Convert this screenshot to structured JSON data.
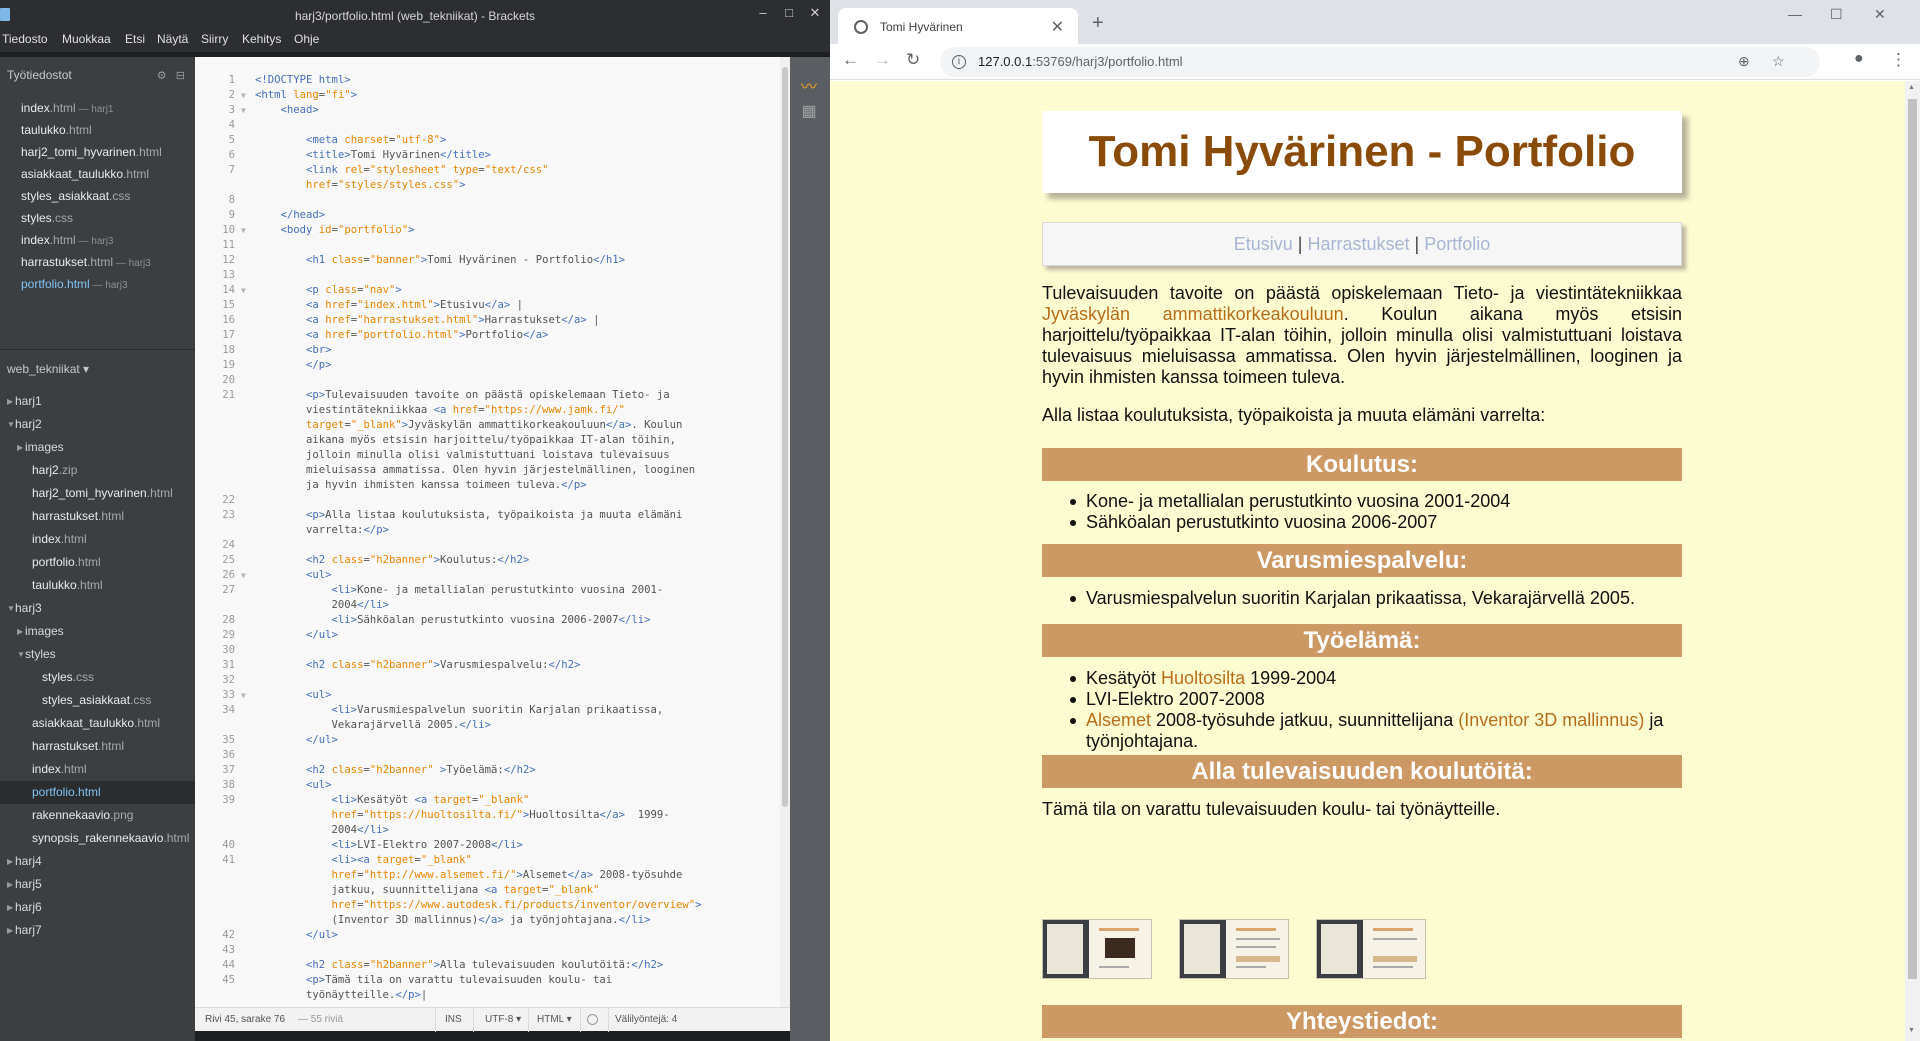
{
  "brackets": {
    "window_title": "harj3/portfolio.html (web_tekniikat) - Brackets",
    "menu": [
      "Tiedosto",
      "Muokkaa",
      "Etsi",
      "Näytä",
      "Siirry",
      "Kehitys",
      "Ohje"
    ],
    "working_files_header": "Työtiedostot",
    "working_files": [
      {
        "name": "index",
        "ext": ".html",
        "dir": " — harj1"
      },
      {
        "name": "taulukko",
        "ext": ".html",
        "dir": ""
      },
      {
        "name": "harj2_tomi_hyvarinen",
        "ext": ".html",
        "dir": ""
      },
      {
        "name": "asiakkaat_taulukko",
        "ext": ".html",
        "dir": ""
      },
      {
        "name": "styles_asiakkaat",
        "ext": ".css",
        "dir": ""
      },
      {
        "name": "styles",
        "ext": ".css",
        "dir": ""
      },
      {
        "name": "index",
        "ext": ".html",
        "dir": " — harj3"
      },
      {
        "name": "harrastukset",
        "ext": ".html",
        "dir": " — harj3"
      },
      {
        "name": "portfolio",
        "ext": ".html",
        "dir": " — harj3"
      }
    ],
    "project_name": "web_tekniikat ▾",
    "tree": [
      {
        "label": "harj1",
        "ext": "",
        "type": "folder",
        "open": false,
        "indent": 0
      },
      {
        "label": "harj2",
        "ext": "",
        "type": "folder",
        "open": true,
        "indent": 0
      },
      {
        "label": "images",
        "ext": "",
        "type": "folder",
        "open": false,
        "indent": 1
      },
      {
        "label": "harj2",
        "ext": ".zip",
        "type": "file",
        "indent": 1
      },
      {
        "label": "harj2_tomi_hyvarinen",
        "ext": ".html",
        "type": "file",
        "indent": 1
      },
      {
        "label": "harrastukset",
        "ext": ".html",
        "type": "file",
        "indent": 1
      },
      {
        "label": "index",
        "ext": ".html",
        "type": "file",
        "indent": 1
      },
      {
        "label": "portfolio",
        "ext": ".html",
        "type": "file",
        "indent": 1
      },
      {
        "label": "taulukko",
        "ext": ".html",
        "type": "file",
        "indent": 1
      },
      {
        "label": "harj3",
        "ext": "",
        "type": "folder",
        "open": true,
        "indent": 0
      },
      {
        "label": "images",
        "ext": "",
        "type": "folder",
        "open": false,
        "indent": 1
      },
      {
        "label": "styles",
        "ext": "",
        "type": "folder",
        "open": true,
        "indent": 1
      },
      {
        "label": "styles",
        "ext": ".css",
        "type": "file",
        "indent": 2
      },
      {
        "label": "styles_asiakkaat",
        "ext": ".css",
        "type": "file",
        "indent": 2
      },
      {
        "label": "asiakkaat_taulukko",
        "ext": ".html",
        "type": "file",
        "indent": 1
      },
      {
        "label": "harrastukset",
        "ext": ".html",
        "type": "file",
        "indent": 1
      },
      {
        "label": "index",
        "ext": ".html",
        "type": "file",
        "indent": 1
      },
      {
        "label": "portfolio",
        "ext": ".html",
        "type": "file",
        "indent": 1,
        "selected": true
      },
      {
        "label": "rakennekaavio",
        "ext": ".png",
        "type": "file",
        "indent": 1
      },
      {
        "label": "synopsis_rakennekaavio",
        "ext": ".html",
        "type": "file",
        "indent": 1
      },
      {
        "label": "harj4",
        "ext": "",
        "type": "folder",
        "open": false,
        "indent": 0
      },
      {
        "label": "harj5",
        "ext": "",
        "type": "folder",
        "open": false,
        "indent": 0
      },
      {
        "label": "harj6",
        "ext": "",
        "type": "folder",
        "open": false,
        "indent": 0
      },
      {
        "label": "harj7",
        "ext": "",
        "type": "folder",
        "open": false,
        "indent": 0
      }
    ],
    "code_lines": [
      {
        "n": "1",
        "fold": "",
        "html": "<span class=\"tg\">&lt;!DOCTYPE html&gt;</span>"
      },
      {
        "n": "2",
        "fold": "▼",
        "html": "<span class=\"tg\">&lt;html</span> <span class=\"at\">lang</span>=<span class=\"st\">\"fi\"</span><span class=\"tg\">&gt;</span>"
      },
      {
        "n": "3",
        "fold": "▼",
        "html": "    <span class=\"tg\">&lt;head&gt;</span>"
      },
      {
        "n": "4",
        "fold": "",
        "html": ""
      },
      {
        "n": "5",
        "fold": "",
        "html": "        <span class=\"tg\">&lt;meta</span> <span class=\"at\">charset</span>=<span class=\"st\">\"utf-8\"</span><span class=\"tg\">&gt;</span>"
      },
      {
        "n": "6",
        "fold": "",
        "html": "        <span class=\"tg\">&lt;title&gt;</span>Tomi Hyvärinen<span class=\"tg\">&lt;/title&gt;</span>"
      },
      {
        "n": "7",
        "fold": "",
        "html": "        <span class=\"tg\">&lt;link</span> <span class=\"at\">rel</span>=<span class=\"st\">\"stylesheet\"</span> <span class=\"at\">type</span>=<span class=\"st\">\"text/css\"</span>"
      },
      {
        "n": "",
        "fold": "",
        "html": "        <span class=\"at\">href</span>=<span class=\"st\">\"styles/styles.css\"</span><span class=\"tg\">&gt;</span>"
      },
      {
        "n": "8",
        "fold": "",
        "html": ""
      },
      {
        "n": "9",
        "fold": "",
        "html": "    <span class=\"tg\">&lt;/head&gt;</span>"
      },
      {
        "n": "10",
        "fold": "▼",
        "html": "    <span class=\"tg\">&lt;body</span> <span class=\"at\">id</span>=<span class=\"st\">\"portfolio\"</span><span class=\"tg\">&gt;</span>"
      },
      {
        "n": "11",
        "fold": "",
        "html": ""
      },
      {
        "n": "12",
        "fold": "",
        "html": "        <span class=\"tg\">&lt;h1</span> <span class=\"at\">class</span>=<span class=\"st\">\"banner\"</span><span class=\"tg\">&gt;</span>Tomi Hyvärinen - Portfolio<span class=\"tg\">&lt;/h1&gt;</span>"
      },
      {
        "n": "13",
        "fold": "",
        "html": ""
      },
      {
        "n": "14",
        "fold": "▼",
        "html": "        <span class=\"tg\">&lt;p</span> <span class=\"at\">class</span>=<span class=\"st\">\"nav\"</span><span class=\"tg\">&gt;</span>"
      },
      {
        "n": "15",
        "fold": "",
        "html": "        <span class=\"tg\">&lt;a</span> <span class=\"at\">href</span>=<span class=\"st\">\"index.html\"</span><span class=\"tg\">&gt;</span>Etusivu<span class=\"tg\">&lt;/a&gt;</span> |"
      },
      {
        "n": "16",
        "fold": "",
        "html": "        <span class=\"tg\">&lt;a</span> <span class=\"at\">href</span>=<span class=\"st\">\"harrastukset.html\"</span><span class=\"tg\">&gt;</span>Harrastukset<span class=\"tg\">&lt;/a&gt;</span> |"
      },
      {
        "n": "17",
        "fold": "",
        "html": "        <span class=\"tg\">&lt;a</span> <span class=\"at\">href</span>=<span class=\"st\">\"portfolio.html\"</span><span class=\"tg\">&gt;</span>Portfolio<span class=\"tg\">&lt;/a&gt;</span>"
      },
      {
        "n": "18",
        "fold": "",
        "html": "        <span class=\"tg\">&lt;br&gt;</span>"
      },
      {
        "n": "19",
        "fold": "",
        "html": "        <span class=\"tg\">&lt;/p&gt;</span>"
      },
      {
        "n": "20",
        "fold": "",
        "html": ""
      },
      {
        "n": "21",
        "fold": "",
        "html": "        <span class=\"tg\">&lt;p&gt;</span>Tulevaisuuden tavoite on päästä opiskelemaan Tieto- ja"
      },
      {
        "n": "",
        "fold": "",
        "html": "        viestintätekniikkaa <span class=\"tg\">&lt;a</span> <span class=\"at\">href</span>=<span class=\"st\">\"https://www.jamk.fi/\"</span>"
      },
      {
        "n": "",
        "fold": "",
        "html": "        <span class=\"at\">target</span>=<span class=\"st\">\"_blank\"</span><span class=\"tg\">&gt;</span>Jyväskylän ammattikorkeakouluun<span class=\"tg\">&lt;/a&gt;</span>. Koulun"
      },
      {
        "n": "",
        "fold": "",
        "html": "        aikana myös etsisin harjoittelu/työpaikkaa IT-alan töihin,"
      },
      {
        "n": "",
        "fold": "",
        "html": "        jolloin minulla olisi valmistuttuani loistava tulevaisuus"
      },
      {
        "n": "",
        "fold": "",
        "html": "        mieluisassa ammatissa. Olen hyvin järjestelmällinen, looginen"
      },
      {
        "n": "",
        "fold": "",
        "html": "        ja hyvin ihmisten kanssa toimeen tuleva.<span class=\"tg\">&lt;/p&gt;</span>"
      },
      {
        "n": "22",
        "fold": "",
        "html": ""
      },
      {
        "n": "23",
        "fold": "",
        "html": "        <span class=\"tg\">&lt;p&gt;</span>Alla listaa koulutuksista, työpaikoista ja muuta elämäni"
      },
      {
        "n": "",
        "fold": "",
        "html": "        varrelta:<span class=\"tg\">&lt;/p&gt;</span>"
      },
      {
        "n": "24",
        "fold": "",
        "html": ""
      },
      {
        "n": "25",
        "fold": "",
        "html": "        <span class=\"tg\">&lt;h2</span> <span class=\"at\">class</span>=<span class=\"st\">\"h2banner\"</span><span class=\"tg\">&gt;</span>Koulutus:<span class=\"tg\">&lt;/h2&gt;</span>"
      },
      {
        "n": "26",
        "fold": "▼",
        "html": "        <span class=\"tg\">&lt;ul&gt;</span>"
      },
      {
        "n": "27",
        "fold": "",
        "html": "            <span class=\"tg\">&lt;li&gt;</span>Kone- ja metallialan perustutkinto vuosina 2001-"
      },
      {
        "n": "",
        "fold": "",
        "html": "            2004<span class=\"tg\">&lt;/li&gt;</span>"
      },
      {
        "n": "28",
        "fold": "",
        "html": "            <span class=\"tg\">&lt;li&gt;</span>Sähköalan perustutkinto vuosina 2006-2007<span class=\"tg\">&lt;/li&gt;</span>"
      },
      {
        "n": "29",
        "fold": "",
        "html": "        <span class=\"tg\">&lt;/ul&gt;</span>"
      },
      {
        "n": "30",
        "fold": "",
        "html": ""
      },
      {
        "n": "31",
        "fold": "",
        "html": "        <span class=\"tg\">&lt;h2</span> <span class=\"at\">class</span>=<span class=\"st\">\"h2banner\"</span><span class=\"tg\">&gt;</span>Varusmiespalvelu:<span class=\"tg\">&lt;/h2&gt;</span>"
      },
      {
        "n": "32",
        "fold": "",
        "html": ""
      },
      {
        "n": "33",
        "fold": "▼",
        "html": "        <span class=\"tg\">&lt;ul&gt;</span>"
      },
      {
        "n": "34",
        "fold": "",
        "html": "            <span class=\"tg\">&lt;li&gt;</span>Varusmiespalvelun suoritin Karjalan prikaatissa,"
      },
      {
        "n": "",
        "fold": "",
        "html": "            Vekarajärvellä 2005.<span class=\"tg\">&lt;/li&gt;</span>"
      },
      {
        "n": "35",
        "fold": "",
        "html": "        <span class=\"tg\">&lt;/ul&gt;</span>"
      },
      {
        "n": "36",
        "fold": "",
        "html": ""
      },
      {
        "n": "37",
        "fold": "",
        "html": "        <span class=\"tg\">&lt;h2</span> <span class=\"at\">class</span>=<span class=\"st\">\"h2banner\"</span> <span class=\"tg\">&gt;</span>Työelämä:<span class=\"tg\">&lt;/h2&gt;</span>"
      },
      {
        "n": "38",
        "fold": "",
        "html": "        <span class=\"tg\">&lt;ul&gt;</span>"
      },
      {
        "n": "39",
        "fold": "",
        "html": "            <span class=\"tg\">&lt;li&gt;</span>Kesätyöt <span class=\"tg\">&lt;a</span> <span class=\"at\">target</span>=<span class=\"st\">\"_blank\"</span>"
      },
      {
        "n": "",
        "fold": "",
        "html": "            <span class=\"at\">href</span>=<span class=\"st\">\"https://huoltosilta.fi/\"</span><span class=\"tg\">&gt;</span>Huoltosilta<span class=\"tg\">&lt;/a&gt;</span>  1999-"
      },
      {
        "n": "",
        "fold": "",
        "html": "            2004<span class=\"tg\">&lt;/li&gt;</span>"
      },
      {
        "n": "40",
        "fold": "",
        "html": "            <span class=\"tg\">&lt;li&gt;</span>LVI-Elektro 2007-2008<span class=\"tg\">&lt;/li&gt;</span>"
      },
      {
        "n": "41",
        "fold": "",
        "html": "            <span class=\"tg\">&lt;li&gt;&lt;a</span> <span class=\"at\">target</span>=<span class=\"st\">\"_blank\"</span>"
      },
      {
        "n": "",
        "fold": "",
        "html": "            <span class=\"at\">href</span>=<span class=\"st\">\"http://www.alsemet.fi/\"</span><span class=\"tg\">&gt;</span>Alsemet<span class=\"tg\">&lt;/a&gt;</span> 2008-työsuhde"
      },
      {
        "n": "",
        "fold": "",
        "html": "            jatkuu, suunnittelijana <span class=\"tg\">&lt;a</span> <span class=\"at\">target</span>=<span class=\"st\">\"_blank\"</span>"
      },
      {
        "n": "",
        "fold": "",
        "html": "            <span class=\"at\">href</span>=<span class=\"st\">\"https://www.autodesk.fi/products/inventor/overview\"</span><span class=\"tg\">&gt;</span>"
      },
      {
        "n": "",
        "fold": "",
        "html": "            (Inventor 3D mallinnus)<span class=\"tg\">&lt;/a&gt;</span> ja työnjohtajana.<span class=\"tg\">&lt;/li&gt;</span>"
      },
      {
        "n": "42",
        "fold": "",
        "html": "        <span class=\"tg\">&lt;/ul&gt;</span>"
      },
      {
        "n": "43",
        "fold": "",
        "html": ""
      },
      {
        "n": "44",
        "fold": "",
        "html": "        <span class=\"tg\">&lt;h2</span> <span class=\"at\">class</span>=<span class=\"st\">\"h2banner\"</span><span class=\"tg\">&gt;</span>Alla tulevaisuuden koulutöitä:<span class=\"tg\">&lt;/h2&gt;</span>"
      },
      {
        "n": "45",
        "fold": "",
        "html": "        <span class=\"tg\">&lt;p&gt;</span>Tämä tila on varattu tulevaisuuden koulu- tai"
      },
      {
        "n": "",
        "fold": "",
        "html": "        työnäytteille.<span class=\"tg\">&lt;/p&gt;</span>|",
        "cursor": true
      }
    ],
    "status": {
      "position": "Rivi 45, sarake 76",
      "lines": " — 55 riviä",
      "mode": "INS",
      "encoding": "UTF-8 ▾",
      "language": "HTML ▾",
      "indent": "Välilyöntejä: 4"
    }
  },
  "chrome": {
    "tab_title": "Tomi Hyvärinen",
    "url_host": "127.0.0.1",
    "url_path": ":53769/harj3/portfolio.html"
  },
  "page": {
    "banner": "Tomi Hyvärinen - Portfolio",
    "nav": {
      "etusivu": "Etusivu",
      "harrastukset": "Harrastukset",
      "portfolio": "Portfolio",
      "sep": " | "
    },
    "intro_before": "Tulevaisuuden tavoite on päästä opiskelemaan Tieto- ja viestintätekniikkaa ",
    "intro_link": "Jyväskylän ammattikorkeakouluun",
    "intro_after": ". Koulun aikana myös etsisin harjoittelu/työpaikkaa IT-alan töihin, jolloin minulla olisi valmistuttuani loistava tulevaisuus mieluisassa ammatissa. Olen hyvin järjestelmällinen, looginen ja hyvin ihmisten kanssa toimeen tuleva.",
    "lead": "Alla listaa koulutuksista, työpaikoista ja muuta elämäni varrelta:",
    "h_koulutus": "Koulutus:",
    "koulutus": [
      "Kone- ja metallialan perustutkinto vuosina 2001-2004",
      "Sähköalan perustutkinto vuosina 2006-2007"
    ],
    "h_varus": "Varusmiespalvelu:",
    "varus": [
      "Varusmiespalvelun suoritin Karjalan prikaatissa, Vekarajärvellä 2005."
    ],
    "h_tyo": "Työelämä:",
    "tyo1_pre": "Kesätyöt ",
    "tyo1_link": "Huoltosilta",
    "tyo1_post": " 1999-2004",
    "tyo2": "LVI-Elektro 2007-2008",
    "tyo3_link": "Alsemet",
    "tyo3_mid": " 2008-työsuhde jatkuu, suunnittelijana ",
    "tyo3_link2": "(Inventor 3D mallinnus)",
    "tyo3_post": " ja työnjohtajana.",
    "h_koulutyot": "Alla tulevaisuuden koulutöitä:",
    "koulutyot_text": "Tämä tila on varattu tulevaisuuden koulu- tai työnäytteille.",
    "h_yhteys": "Yhteystiedot:"
  }
}
